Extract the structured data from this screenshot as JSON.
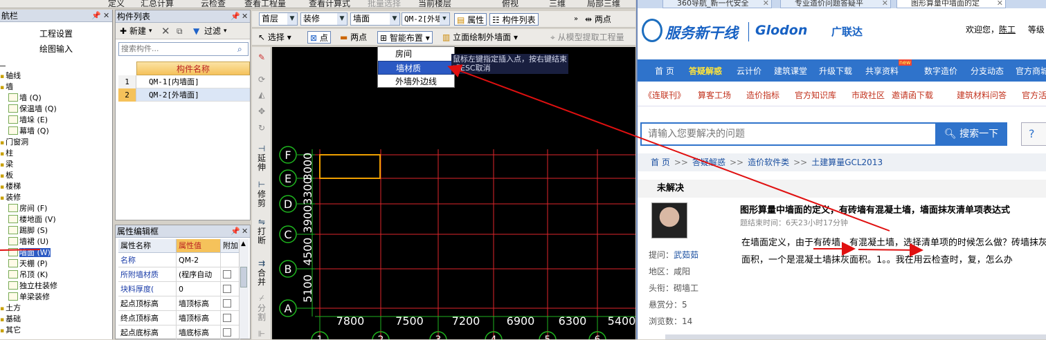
{
  "top_strip": [
    "定义",
    "汇总计算",
    "云检查",
    "查看工程量",
    "查看计算式",
    "批量选择",
    "当前楼层",
    "俯视",
    "三维",
    "局部三维"
  ],
  "nav_panel": {
    "title": "航栏",
    "buttons": [
      "工程设置",
      "绘图输入"
    ],
    "tree": [
      {
        "label": "轴线",
        "level": 0
      },
      {
        "label": "墙",
        "level": 0
      },
      {
        "label": "墙 (Q)",
        "level": 1
      },
      {
        "label": "保温墙 (Q)",
        "level": 1
      },
      {
        "label": "墙垛 (E)",
        "level": 1
      },
      {
        "label": "幕墙 (Q)",
        "level": 1
      },
      {
        "label": "门窗洞",
        "level": 0
      },
      {
        "label": "柱",
        "level": 0
      },
      {
        "label": "梁",
        "level": 0
      },
      {
        "label": "板",
        "level": 0
      },
      {
        "label": "楼梯",
        "level": 0
      },
      {
        "label": "装修",
        "level": 0
      },
      {
        "label": "房间 (F)",
        "level": 1
      },
      {
        "label": "楼地面 (V)",
        "level": 1
      },
      {
        "label": "踢脚 (S)",
        "level": 1
      },
      {
        "label": "墙裙 (U)",
        "level": 1
      },
      {
        "label": "墙面 (W)",
        "level": 1,
        "selected": true
      },
      {
        "label": "天棚 (P)",
        "level": 1
      },
      {
        "label": "吊顶 (K)",
        "level": 1
      },
      {
        "label": "独立柱装修",
        "level": 1
      },
      {
        "label": "单梁装修",
        "level": 1
      },
      {
        "label": "土方",
        "level": 0
      },
      {
        "label": "基础",
        "level": 0
      },
      {
        "label": "其它",
        "level": 0
      }
    ]
  },
  "comp_panel": {
    "title": "构件列表",
    "toolbar": {
      "new": "新建",
      "filter": "过滤"
    },
    "search_placeholder": "搜索构件...",
    "header": "构件名称",
    "rows": [
      {
        "n": "1",
        "name": "QM-1[内墙面]"
      },
      {
        "n": "2",
        "name": "QM-2[外墙面]"
      }
    ]
  },
  "prop_panel": {
    "title": "属性编辑框",
    "headers": [
      "属性名称",
      "属性值",
      "附加"
    ],
    "rows": [
      {
        "name": "名称",
        "value": "QM-2"
      },
      {
        "name": "所附墙材质",
        "value": "(程序自动"
      },
      {
        "name": "块料厚度(",
        "value": "0"
      },
      {
        "name": "起点顶标高",
        "value": "墙顶标高"
      },
      {
        "name": "终点顶标高",
        "value": "墙顶标高"
      },
      {
        "name": "起点底标高",
        "value": "墙底标高"
      }
    ]
  },
  "cad_toolbar1": {
    "floor": "首层",
    "category": "装修",
    "type": "墙面",
    "component": "QM-2[外墙",
    "attr": "属性",
    "comp_list": "构件列表",
    "two_pt": "两点"
  },
  "cad_toolbar2": {
    "select": "选择",
    "point": "点",
    "two_pt": "两点",
    "smart": "智能布置",
    "facade": "立面绘制外墙面",
    "extract": "从模型提取工程量"
  },
  "smart_menu": [
    "房间",
    "墙材质",
    "外墙外边线"
  ],
  "tooltip": "鼠标左键指定插入点，按右键结束或ESC取消",
  "vstrip": {
    "extend": "延伸",
    "trim": "修剪",
    "break": "打断",
    "merge": "合并",
    "split": "分割"
  },
  "cad": {
    "row_axes": [
      "F",
      "E",
      "D",
      "C",
      "B",
      "A"
    ],
    "row_dims": [
      "3000",
      "3300",
      "3900",
      "4500",
      "5100"
    ],
    "col_dims": [
      "7800",
      "7500",
      "7200",
      "6900",
      "6300",
      "5400"
    ],
    "col_axes": [
      "1",
      "2",
      "3",
      "4",
      "5",
      "6"
    ]
  },
  "browser": {
    "tabs": [
      "360导航_新一代安全",
      "专业造价问题答疑平",
      "图形算量中墙面的定"
    ],
    "brand": "服务新干线",
    "brand2": "Glodon",
    "brand3": "广联达",
    "welcome": "欢迎您，",
    "user": "陈工",
    "welcome_tail": "等级",
    "nav": [
      "首 页",
      "答疑解惑",
      "云计价",
      "建筑课堂",
      "升级下载",
      "共享资料",
      "数字造价",
      "分支动态",
      "官方商城"
    ],
    "nav_new_badge": "new",
    "sub_nav": [
      "《连联刊》",
      "算客工场",
      "造价指标",
      "官方知识库",
      "市政社区",
      "邀请函下载",
      "建筑材料问答",
      "官方活动"
    ],
    "search_placeholder": "请输入您要解决的问题",
    "search_btn": "搜索一下",
    "help": "?",
    "breadcrumb": [
      "首 页",
      "答疑解惑",
      "造价软件类",
      "土建算量GCL2013"
    ],
    "status": "未解决",
    "question_title": "图形算量中墙面的定义，有砖墙有混凝土墙，墙面抹灰清单项表达式",
    "question_meta": "题结束时间：6天23小时17分钟",
    "question_body": "在墙面定义，由于有砖墙，有混凝土墙，选择清单项的时候怎么做？砖墙抹灰面积，一个是混凝土墙抹灰面积。1。。我在用云检查时，复，怎么办",
    "asker": [
      {
        "k": "提问：",
        "v": "武茹茹"
      },
      {
        "k": "地区：",
        "v": "咸阳"
      },
      {
        "k": "头衔：",
        "v": "砌墙工"
      },
      {
        "k": "悬赏分：",
        "v": "5"
      },
      {
        "k": "浏览数：",
        "v": "14"
      }
    ]
  }
}
